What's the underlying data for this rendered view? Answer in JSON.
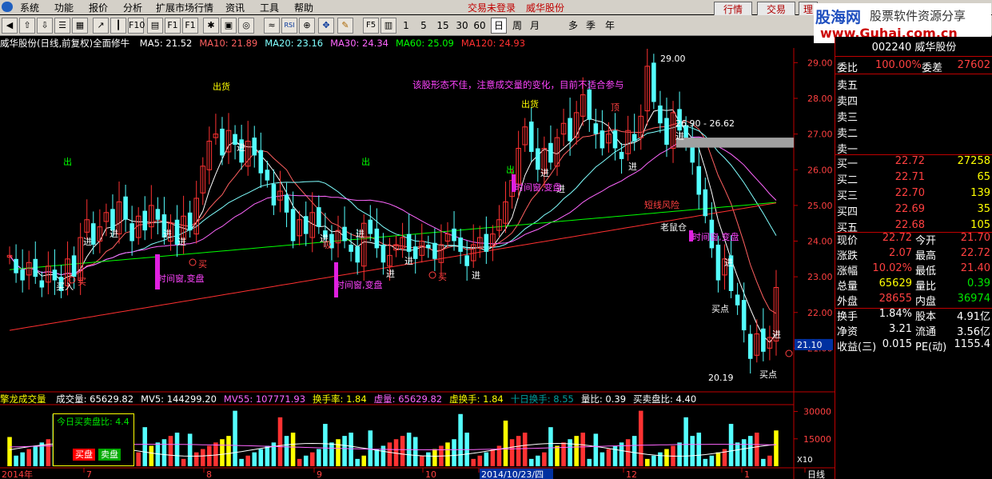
{
  "menu": [
    "系统",
    "功能",
    "报价",
    "分析",
    "扩展市场行情",
    "资讯",
    "工具",
    "帮助"
  ],
  "header_status": {
    "login": "交易未登录",
    "stock": "威华股份"
  },
  "top_buttons": [
    "行情",
    "交易",
    "理"
  ],
  "watermark": {
    "line1": "股海网",
    "line2": "股票软件资源分享",
    "url": "www.Guhai.com.cn"
  },
  "toolbar": {
    "periods": [
      "1",
      "5",
      "15",
      "30",
      "60"
    ],
    "period_btns": [
      "日",
      "周",
      "月",
      "多",
      "季",
      "年"
    ],
    "f5": "F5"
  },
  "ma_bar": {
    "title": "威华股份(日线,前复权)全面修牛",
    "items": [
      {
        "label": "MA5: 21.52",
        "color": "#ffffff"
      },
      {
        "label": "MA10: 21.89",
        "color": "#ff6060"
      },
      {
        "label": "MA20: 23.16",
        "color": "#80ffff"
      },
      {
        "label": "MA30: 24.34",
        "color": "#ff66ff"
      },
      {
        "label": "MA60: 25.09",
        "color": "#00ff00"
      },
      {
        "label": "MA120: 24.93",
        "color": "#ff3030"
      }
    ]
  },
  "price_axis": [
    "29.00",
    "28.00",
    "27.00",
    "26.00",
    "25.00",
    "24.00",
    "23.00",
    "22.00",
    "21.00"
  ],
  "current_price_tag": "21.10",
  "annotations": {
    "comment": "该股形态不佳，注意成交量的变化，目前不适合参与",
    "high": "29.00",
    "low": "20.19",
    "range": "26.90 - 26.62",
    "chu_huo": "出货",
    "chu": "出",
    "jin": "进",
    "buy_in": "买入",
    "buy": "买",
    "buy_point": "买点",
    "ding": "顶",
    "time_window": "时间窗,变盘",
    "short_line": "短线风险",
    "laoshu": "老鼠仓",
    "xi": "吸"
  },
  "vol_bar": {
    "title": "擎龙成交量",
    "items": [
      {
        "label": "成交量: 65629.82",
        "color": "#ffffff"
      },
      {
        "label": "MV5: 144299.20",
        "color": "#ffffff"
      },
      {
        "label": "MV55: 107771.93",
        "color": "#ff66ff"
      },
      {
        "label": "换手率: 1.84",
        "color": "#ffff00"
      },
      {
        "label": "虚量: 65629.82",
        "color": "#ff66ff"
      },
      {
        "label": "虚换手: 1.84",
        "color": "#ffff00"
      },
      {
        "label": "十日换手: 8.55",
        "color": "#00a0a0"
      },
      {
        "label": "量比: 0.39",
        "color": "#ffffff"
      },
      {
        "label": "买卖盘比: 4.40",
        "color": "#ffffff"
      }
    ],
    "today_ratio": "今日买卖盘比: 4.4",
    "buy_btn": "买盘",
    "sell_btn": "卖盘",
    "axis": [
      "30000",
      "15000",
      "X10"
    ]
  },
  "date_axis": [
    "2014年",
    "7",
    "8",
    "9",
    "10",
    "2014/10/23/四",
    "12",
    "1",
    "日线"
  ],
  "quote": {
    "code": "002240 威华股份",
    "weibi_label": "委比",
    "weibi": "100.00%",
    "weicha_label": "委差",
    "weicha": "27602",
    "sell": [
      {
        "label": "卖五"
      },
      {
        "label": "卖四"
      },
      {
        "label": "卖三"
      },
      {
        "label": "卖二"
      },
      {
        "label": "卖一"
      }
    ],
    "buy": [
      {
        "label": "买一",
        "price": "22.72",
        "vol": "27258"
      },
      {
        "label": "买二",
        "price": "22.71",
        "vol": "65"
      },
      {
        "label": "买三",
        "price": "22.70",
        "vol": "139"
      },
      {
        "label": "买四",
        "price": "22.69",
        "vol": "35"
      },
      {
        "label": "买五",
        "price": "22.68",
        "vol": "105"
      }
    ],
    "stats": [
      {
        "l1": "现价",
        "v1": "22.72",
        "c1": "#ff4040",
        "l2": "今开",
        "v2": "21.70",
        "c2": "#ff4040"
      },
      {
        "l1": "涨跌",
        "v1": "2.07",
        "c1": "#ff4040",
        "l2": "最高",
        "v2": "22.72",
        "c2": "#ff4040"
      },
      {
        "l1": "涨幅",
        "v1": "10.02%",
        "c1": "#ff4040",
        "l2": "最低",
        "v2": "21.40",
        "c2": "#ff4040"
      },
      {
        "l1": "总量",
        "v1": "65629",
        "c1": "#ffff00",
        "l2": "量比",
        "v2": "0.39",
        "c2": "#00e600"
      },
      {
        "l1": "外盘",
        "v1": "28655",
        "c1": "#ff4040",
        "l2": "内盘",
        "v2": "36974",
        "c2": "#00e600"
      },
      {
        "l1": "换手",
        "v1": "1.84%",
        "c1": "#ffffff",
        "l2": "股本",
        "v2": "4.91亿",
        "c2": "#ffffff"
      },
      {
        "l1": "净资",
        "v1": "3.21",
        "c1": "#ffffff",
        "l2": "流通",
        "v2": "3.56亿",
        "c2": "#ffffff"
      },
      {
        "l1": "收益(三)",
        "v1": "0.015",
        "c1": "#ffffff",
        "l2": "PE(动)",
        "v2": "1155.4",
        "c2": "#ffffff"
      }
    ]
  },
  "chart_data": {
    "type": "candlestick",
    "price_range": [
      20.0,
      29.3
    ],
    "volume_range": [
      0,
      32000
    ],
    "closes": [
      23.6,
      23.1,
      22.9,
      23.4,
      23.0,
      22.7,
      23.3,
      22.9,
      22.6,
      23.5,
      23.0,
      24.1,
      24.6,
      23.9,
      24.4,
      24.8,
      24.3,
      25.1,
      24.6,
      24.0,
      24.7,
      24.3,
      25.0,
      24.6,
      24.1,
      24.5,
      23.9,
      24.7,
      24.3,
      25.2,
      26.1,
      26.8,
      27.0,
      26.4,
      27.1,
      26.7,
      26.2,
      26.8,
      26.4,
      25.9,
      25.7,
      25.0,
      25.4,
      24.8,
      24.0,
      24.6,
      24.2,
      24.8,
      24.4,
      24.1,
      23.8,
      24.3,
      24.0,
      23.7,
      23.4,
      24.5,
      24.2,
      23.8,
      23.4,
      23.6,
      23.9,
      24.1,
      23.7,
      23.5,
      24.0,
      23.8,
      23.5,
      23.9,
      24.2,
      24.0,
      23.7,
      23.3,
      23.9,
      24.1,
      23.7,
      24.2,
      24.6,
      25.1,
      25.7,
      26.6,
      27.2,
      26.5,
      26.0,
      26.6,
      26.2,
      26.9,
      27.3,
      26.8,
      27.6,
      28.1,
      27.4,
      27.0,
      26.6,
      27.0,
      26.6,
      26.3,
      27.1,
      26.8,
      27.5,
      28.9,
      27.9,
      27.3,
      26.7,
      27.6,
      27.1,
      26.8,
      26.2,
      25.3,
      24.7,
      23.8,
      22.9,
      23.5,
      22.6,
      22.2,
      21.5,
      20.7,
      21.4,
      20.9,
      21.3,
      22.7
    ]
  }
}
